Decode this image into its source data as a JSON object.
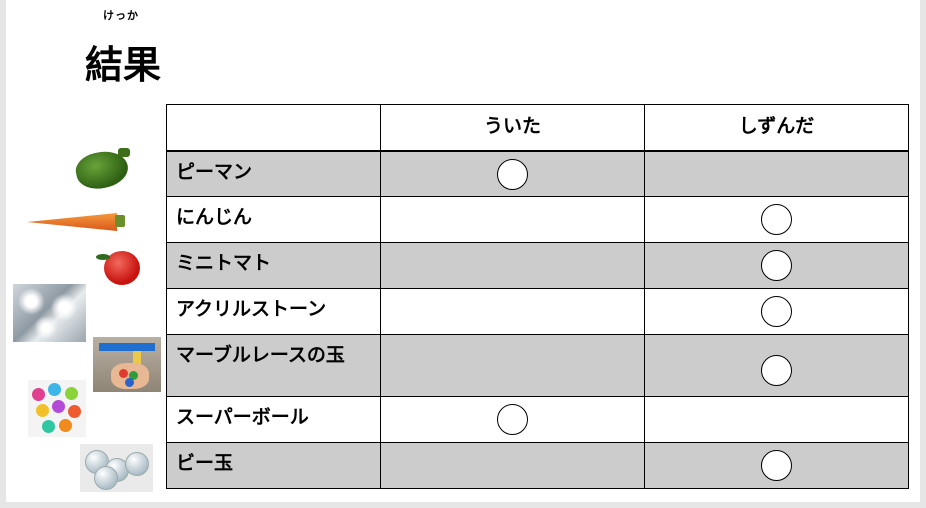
{
  "heading": {
    "ruby": "けっか",
    "title": "結果"
  },
  "table": {
    "columns": [
      "",
      "ういた",
      "しずんだ"
    ],
    "rows": [
      {
        "label": "ピーマン",
        "floated": true,
        "sank": false
      },
      {
        "label": "にんじん",
        "floated": false,
        "sank": true
      },
      {
        "label": "ミニトマト",
        "floated": false,
        "sank": true
      },
      {
        "label": "アクリルストーン",
        "floated": false,
        "sank": true
      },
      {
        "label": "マーブルレースの玉",
        "floated": false,
        "sank": true
      },
      {
        "label": "スーパーボール",
        "floated": true,
        "sank": false
      },
      {
        "label": "ビー玉",
        "floated": false,
        "sank": true
      }
    ]
  },
  "colors": {
    "shaded_row": "#cccccc",
    "border": "#000000",
    "mark": "#ffffff"
  },
  "pictures": [
    "pepper-photo",
    "carrot-photo",
    "tomato-photo",
    "acrylic-stone-photo",
    "marble-race-photo",
    "super-ball-photo",
    "marble-photo"
  ]
}
